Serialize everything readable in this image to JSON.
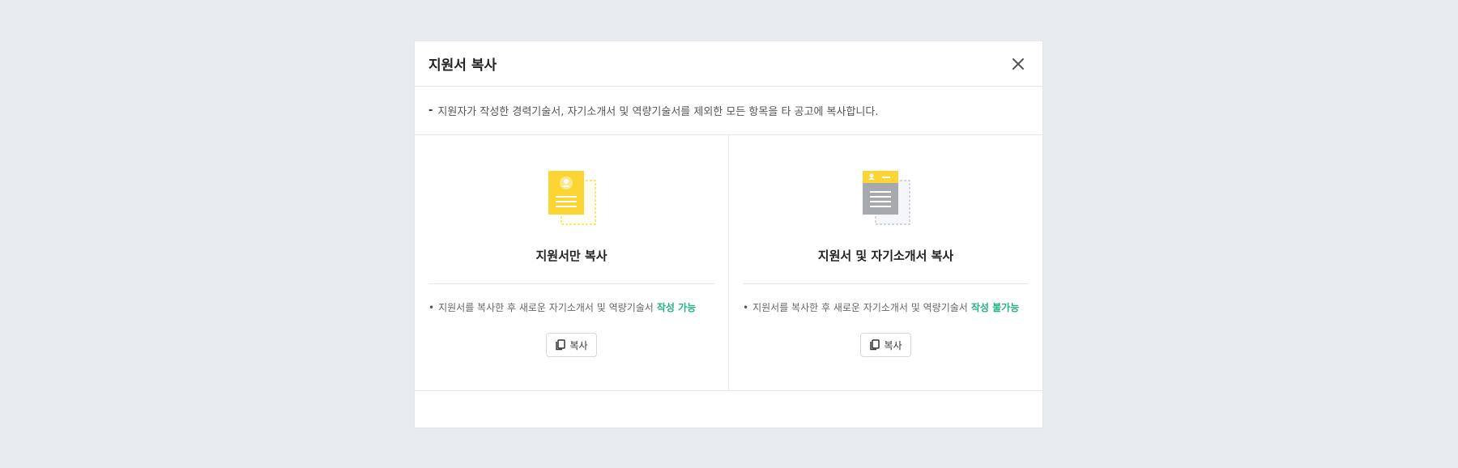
{
  "modal": {
    "title": "지원서 복사",
    "notice_dash": "-",
    "notice": "지원자가 작성한 경력기술서, 자기소개서 및 역량기술서를 제외한 모든 항목을 타 공고에 복사합니다."
  },
  "options": [
    {
      "title": "지원서만 복사",
      "description": "지원서를 복사한 후 새로운 자기소개서 및 역량기술서",
      "status": "작성 가능",
      "button_label": "복사",
      "icon": "document-copy-icon"
    },
    {
      "title": "지원서 및 자기소개서 복사",
      "description": "지원서를 복사한 후 새로운 자기소개서 및 역량기술서",
      "status": "작성 불가능",
      "button_label": "복사",
      "icon": "document-with-cover-copy-icon"
    }
  ],
  "colors": {
    "accent_yellow": "#fcd535",
    "status_green": "#20b383",
    "doc_gray": "#a6a9ae"
  }
}
